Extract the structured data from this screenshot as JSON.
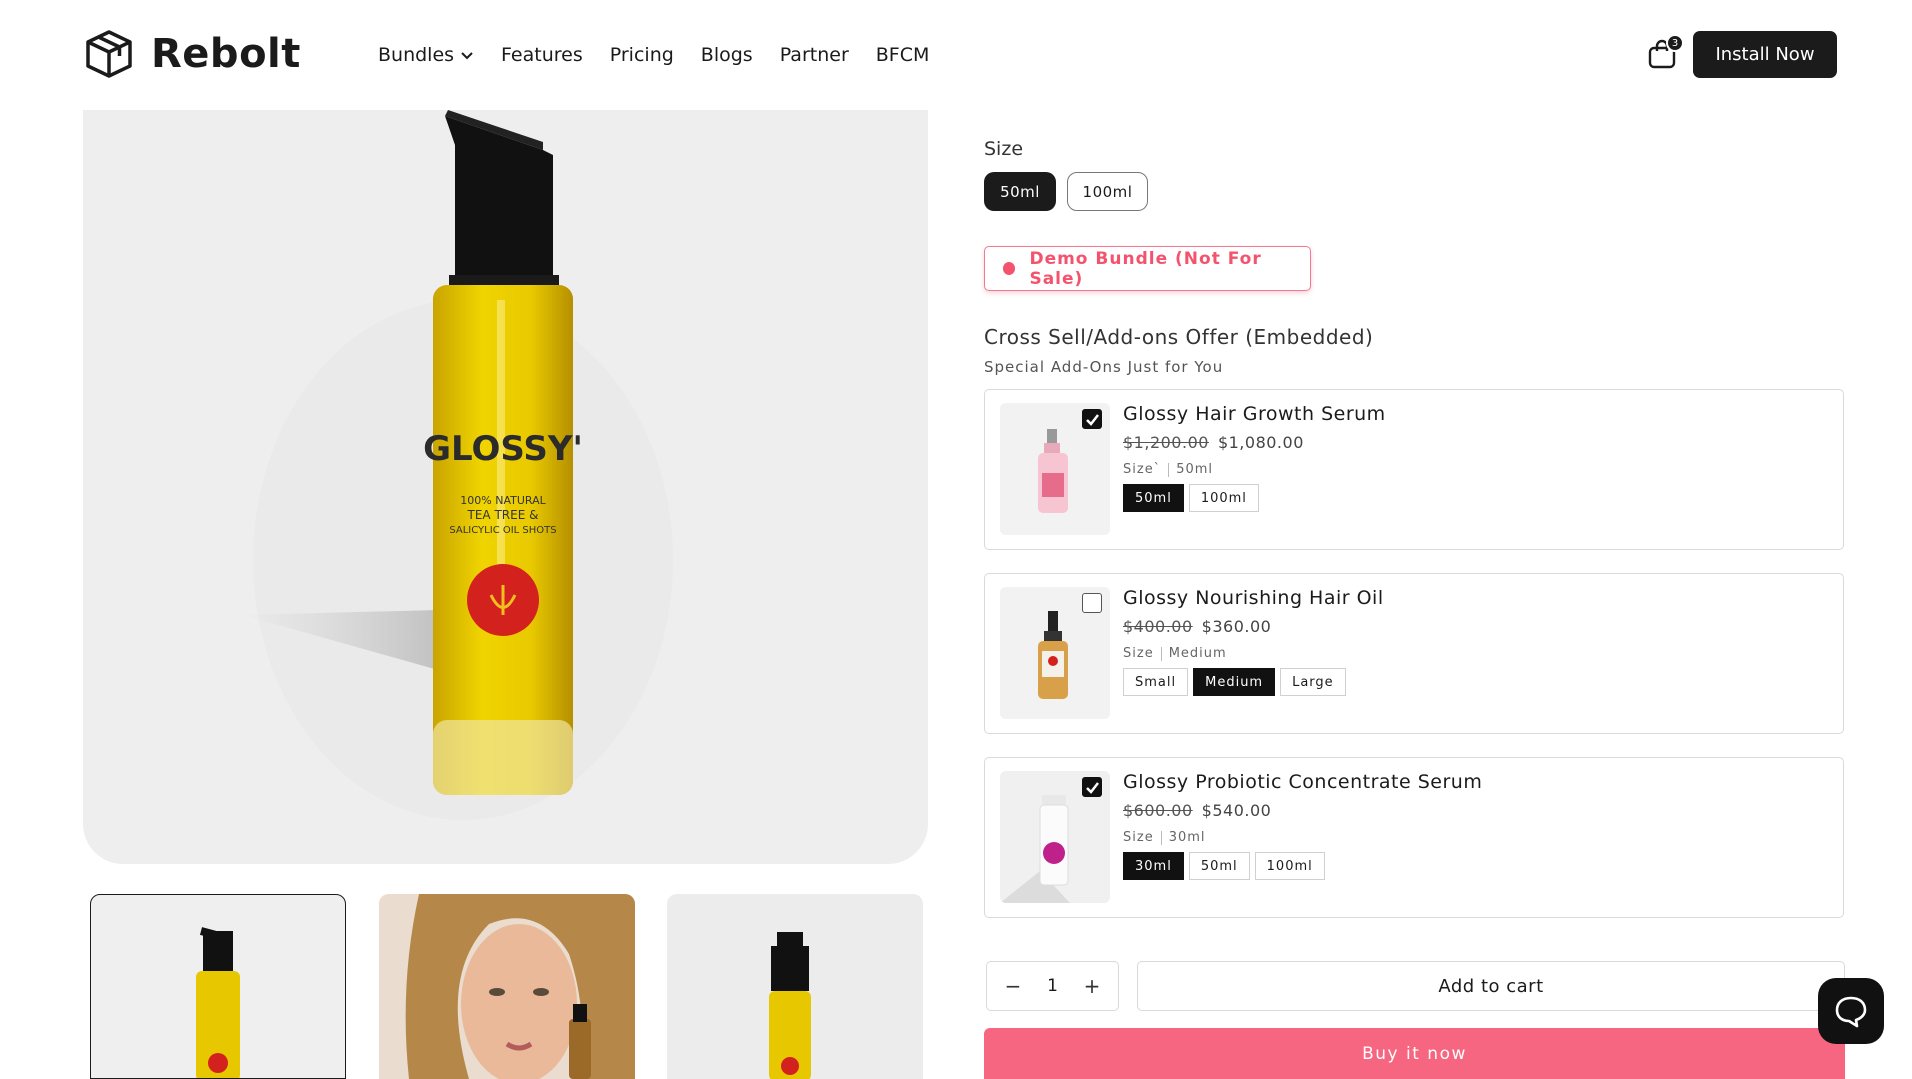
{
  "brand": {
    "name": "Rebolt",
    "logo_icon": "box-icon"
  },
  "nav": {
    "items": [
      {
        "label": "Bundles",
        "has_dropdown": true
      },
      {
        "label": "Features"
      },
      {
        "label": "Pricing"
      },
      {
        "label": "Blogs"
      },
      {
        "label": "Partner"
      },
      {
        "label": "BFCM"
      }
    ]
  },
  "cart": {
    "count": "3",
    "icon": "shopping-bag-icon"
  },
  "header": {
    "install_label": "Install Now"
  },
  "product": {
    "size_label": "Size",
    "sizes": [
      "50ml",
      "100ml"
    ],
    "selected_size": "50ml",
    "main_image": {
      "brand_text": "GLOSSY'",
      "label_lines": [
        "100% NATURAL",
        "TEA TREE &",
        "SALICYLIC OIL SHOTS"
      ]
    }
  },
  "demo_badge": {
    "text": "Demo Bundle (Not For Sale)",
    "color": "#f4536e"
  },
  "cross_sell": {
    "title": "Cross Sell/Add-ons Offer (Embedded)",
    "subtitle": "Special Add-Ons Just for You",
    "offers": [
      {
        "name": "Glossy Hair Growth Serum",
        "old_price": "$1,200.00",
        "price": "$1,080.00",
        "size_label": "Size`",
        "size_value": "50ml",
        "options": [
          "50ml",
          "100ml"
        ],
        "selected": "50ml",
        "checked": true
      },
      {
        "name": "Glossy Nourishing Hair Oil",
        "old_price": "$400.00",
        "price": "$360.00",
        "size_label": "Size",
        "size_value": "Medium",
        "options": [
          "Small",
          "Medium",
          "Large"
        ],
        "selected": "Medium",
        "checked": false
      },
      {
        "name": "Glossy Probiotic Concentrate Serum",
        "old_price": "$600.00",
        "price": "$540.00",
        "size_label": "Size",
        "size_value": "30ml",
        "options": [
          "30ml",
          "50ml",
          "100ml"
        ],
        "selected": "30ml",
        "checked": true
      }
    ]
  },
  "purchase": {
    "quantity": "1",
    "minus": "−",
    "plus": "+",
    "add_to_cart": "Add to cart",
    "buy_now": "Buy it now",
    "buy_color": "#f66681"
  },
  "chat": {
    "icon": "chat-bubble-icon"
  }
}
